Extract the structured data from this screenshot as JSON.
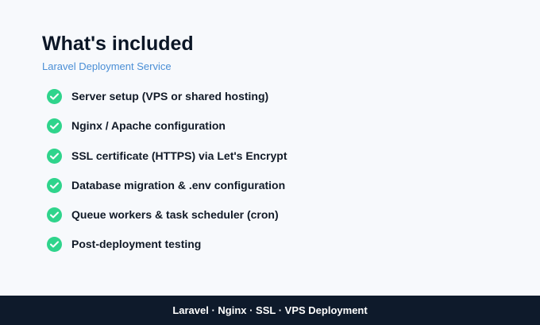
{
  "header": {
    "title": "What's included",
    "subtitle": "Laravel Deployment Service"
  },
  "features": [
    {
      "label": "Server setup (VPS or shared hosting)",
      "icon": "check-circle-icon"
    },
    {
      "label": "Nginx / Apache configuration",
      "icon": "check-circle-icon"
    },
    {
      "label": "SSL certificate (HTTPS) via Let's Encrypt",
      "icon": "check-circle-icon"
    },
    {
      "label": "Database migration & .env configuration",
      "icon": "check-circle-icon"
    },
    {
      "label": "Queue workers & task scheduler (cron)",
      "icon": "check-circle-icon"
    },
    {
      "label": "Post-deployment testing",
      "icon": "check-circle-icon"
    }
  ],
  "footer": {
    "text": "Laravel · Nginx · SSL · VPS Deployment"
  },
  "colors": {
    "background": "#f7f9fc",
    "accent": "#4b8fd6",
    "check": "#2fd48c",
    "footer_bg": "#0e1a2b"
  }
}
